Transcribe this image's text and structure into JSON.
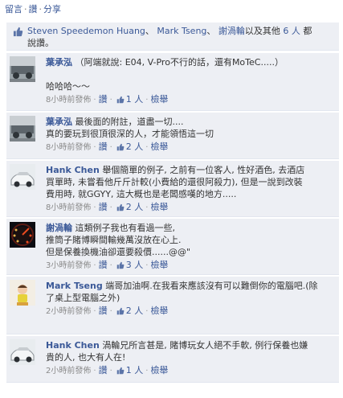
{
  "actions": {
    "comment": "留言",
    "like": "讚",
    "share": "分享",
    "sep": "·"
  },
  "likes": {
    "names": [
      "Steven Speedemon Huang",
      "Mark Tseng",
      "謝渦輪"
    ],
    "sep1": "、",
    "sep2": "、",
    "and_others": "以及其他",
    "others_count": "6 人",
    "suffix_1": "都",
    "suffix_2": "說讚。"
  },
  "comments": [
    {
      "author": "葉承泓",
      "lines": [
        "（阿端就說: E04, V-Pro不行的話，還有MoTeC.....）",
        "",
        "哈哈哈～～"
      ],
      "time": "8小時前發佈",
      "like": "讚",
      "like_count": "1 人",
      "report": "檢舉"
    },
    {
      "author": "葉承泓",
      "lines": [
        "最後面的附註，道盡一切....",
        "真的要玩到很頂很深的人，才能領悟這一切"
      ],
      "time": "8小時前發佈",
      "like": "讚",
      "like_count": "2 人",
      "report": "檢舉"
    },
    {
      "author": "Hank Chen",
      "lines": [
        "舉個簡單的例子, 之前有一位客人, 性好酒色, 去酒店",
        "買單時, 未嘗看他斤斤計較(小費給的還很阿殺力), 但是一說到改裝",
        "費用時, 就GGYY, 這大概也是老闆感嘆的地方....."
      ],
      "time": "8小時前發佈",
      "like": "讚",
      "like_count": "2 人",
      "report": "檢舉"
    },
    {
      "author": "謝渦輪",
      "lines": [
        "這類例子我也有看過一些,",
        "推筒子賭博瞬間輸幾萬沒放在心上.",
        "但是保養換機油卻還要殺價......@@\""
      ],
      "time": "3小時前發佈",
      "like": "讚",
      "like_count": "3 人",
      "report": "檢舉"
    },
    {
      "author": "Mark Tseng",
      "lines": [
        "端哥加油啊.在我看來應該沒有可以難倒你的電腦吧.(除",
        "了桌上型電腦之外)"
      ],
      "time": "2小時前發佈",
      "like": "讚",
      "like_count": "2 人",
      "report": "檢舉"
    },
    {
      "author": "Hank Chen",
      "lines": [
        "渦輪兄所言甚是, 賭博玩女人絕不手軟, 例行保養也嫌",
        "貴的人, 也大有人在!"
      ],
      "time": "2小時前發佈",
      "like": "讚",
      "like_count": "1 人",
      "report": "檢舉"
    }
  ],
  "colors": {
    "link": "#3b5998",
    "panel": "#edeff4",
    "meta": "#8a8a8a"
  }
}
